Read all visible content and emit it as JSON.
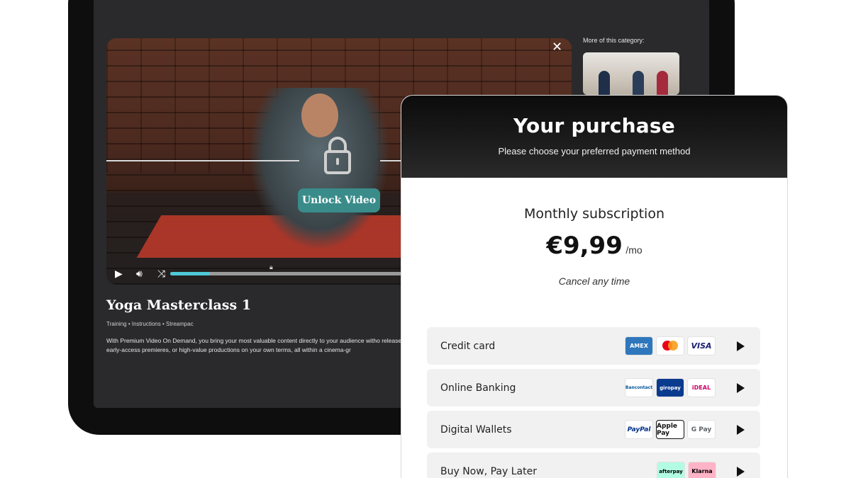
{
  "video": {
    "unlock_label": "Unlock Video",
    "progress_fraction": 0.1
  },
  "sidebar": {
    "more_label": "More of this category:"
  },
  "content": {
    "title": "Yoga Masterclass 1",
    "tags": "Training  •  Instructions  •  Streampac",
    "description": "With Premium Video On Demand, you bring your most valuable content directly to your audience witho releases, early-access premieres, or high-value productions on your own terms, all within a cinema-gr"
  },
  "purchase": {
    "title": "Your purchase",
    "subtitle": "Please choose your preferred payment method",
    "plan": "Monthly subscription",
    "price": "€9,99",
    "period": "/mo",
    "cancel_note": "Cancel any time",
    "methods": [
      {
        "label": "Credit card",
        "logos": [
          "AMEX",
          "mastercard",
          "VISA"
        ]
      },
      {
        "label": "Online Banking",
        "logos": [
          "Bancontact",
          "giropay",
          "iDEAL"
        ]
      },
      {
        "label": "Digital Wallets",
        "logos": [
          "PayPal",
          "Apple Pay",
          "G Pay"
        ]
      },
      {
        "label": "Buy Now, Pay Later",
        "logos": [
          "afterpay",
          "Klarna"
        ]
      }
    ]
  },
  "colors": {
    "accent_teal": "#3a8c8a",
    "progress": "#4ec9d6"
  }
}
